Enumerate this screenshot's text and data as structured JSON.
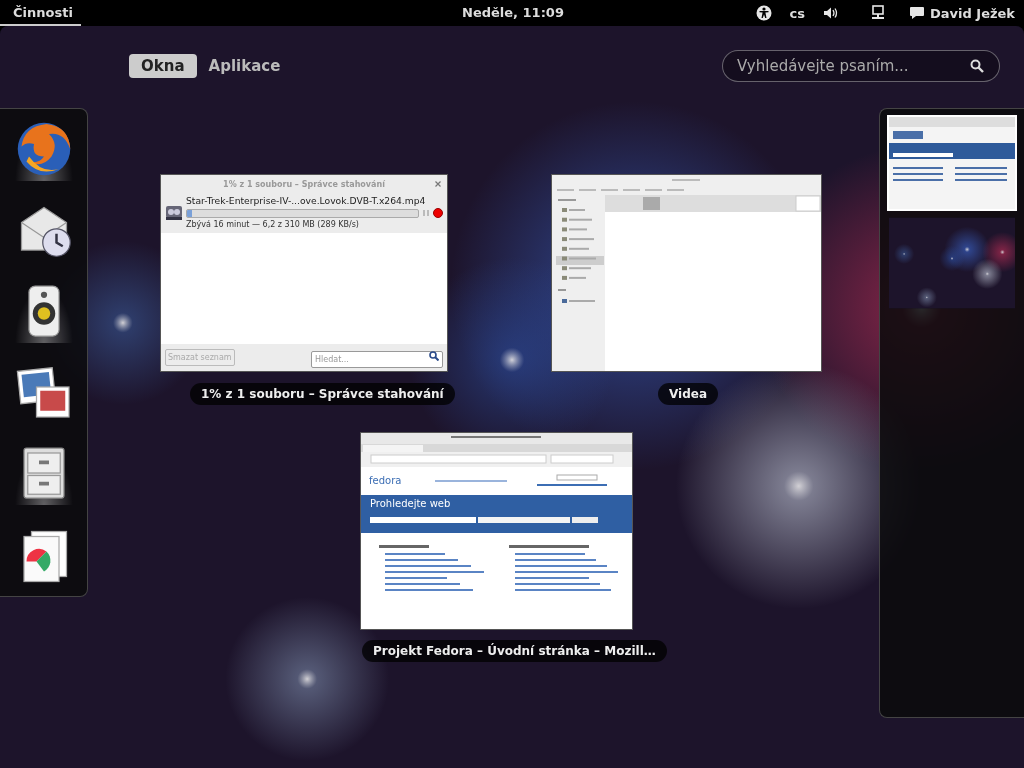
{
  "top_bar": {
    "activities": {
      "label": "Činnosti",
      "selected": true
    },
    "clock": "Neděle, 11:09",
    "language": "cs",
    "user": "David Ježek"
  },
  "view_tabs": [
    {
      "label": "Okna",
      "selected": true
    },
    {
      "label": "Aplikace",
      "selected": false
    }
  ],
  "search": {
    "placeholder": "Vyhledávejte psaním..."
  },
  "dash": [
    {
      "kind": "browser",
      "running": true
    },
    {
      "kind": "mail",
      "running": false
    },
    {
      "kind": "music",
      "running": true
    },
    {
      "kind": "photos",
      "running": false
    },
    {
      "kind": "files",
      "running": true
    },
    {
      "kind": "office",
      "running": false
    }
  ],
  "windows": [
    {
      "kind": "downloads",
      "title": "1% z 1 souboru – Správce stahování",
      "caption": "1% z 1 souboru – Správce stahování",
      "file": "Star-Trek-Enterprise-IV-...ove.Lovok.DVB-T.x264.mp4",
      "level": 0.02,
      "status": "Zbývá 16 minut — 6,2 z 310 MB (289 KB/s)",
      "clear_button": {
        "label": "Smazat seznam",
        "disabled": true
      },
      "search_placeholder": "Hledat..."
    },
    {
      "kind": "files",
      "caption": "Videa"
    },
    {
      "kind": "browser",
      "caption": "Projekt Fedora – Úvodní stránka – Mozill…",
      "logo": "fedora",
      "banner": "Prohledejte web"
    }
  ],
  "workspaces": [
    {
      "kind": "windows",
      "selected": true
    },
    {
      "kind": "empty",
      "selected": false
    }
  ]
}
